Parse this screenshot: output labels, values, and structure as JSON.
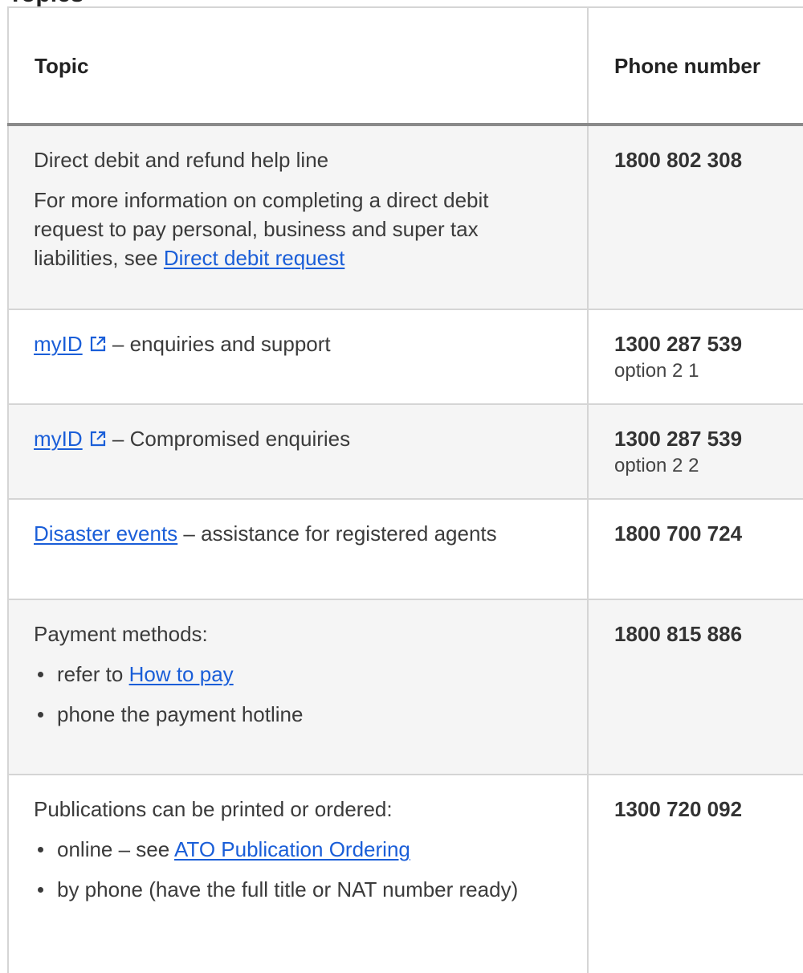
{
  "header_heading_partial": "Topics",
  "table": {
    "headers": {
      "topic": "Topic",
      "phone": "Phone number"
    },
    "rows": [
      {
        "text": "Direct debit and refund help line",
        "info_prefix": "For more information on completing a direct debit request to pay personal, business and super tax liabilities, see ",
        "info_link": "Direct debit request",
        "phone": "1800 802 308"
      },
      {
        "link": "myID",
        "suffix": " – enquiries and support",
        "phone": "1300 287 539",
        "option": "option 2 1"
      },
      {
        "link": "myID",
        "suffix": " – Compromised enquiries",
        "phone": "1300 287 539",
        "option": "option 2 2"
      },
      {
        "link": "Disaster events",
        "suffix": " – assistance for registered agents",
        "phone": "1800 700 724"
      },
      {
        "text": "Payment methods:",
        "bullet1_prefix": "refer to ",
        "bullet1_link": "How to pay",
        "bullet2": "phone the payment hotline",
        "phone": "1800 815 886"
      },
      {
        "text": "Publications can be printed or ordered:",
        "bullet1_prefix": "online – see ",
        "bullet1_link": "ATO Publication Ordering",
        "bullet2": "by phone (have the full title or NAT number ready)",
        "phone": "1300 720 092"
      }
    ]
  },
  "icons": {
    "external_link": "external-link-icon"
  },
  "colors": {
    "link": "#1a5ed8",
    "row_shaded": "#f5f5f5",
    "header_rule": "#8a8a8a"
  }
}
